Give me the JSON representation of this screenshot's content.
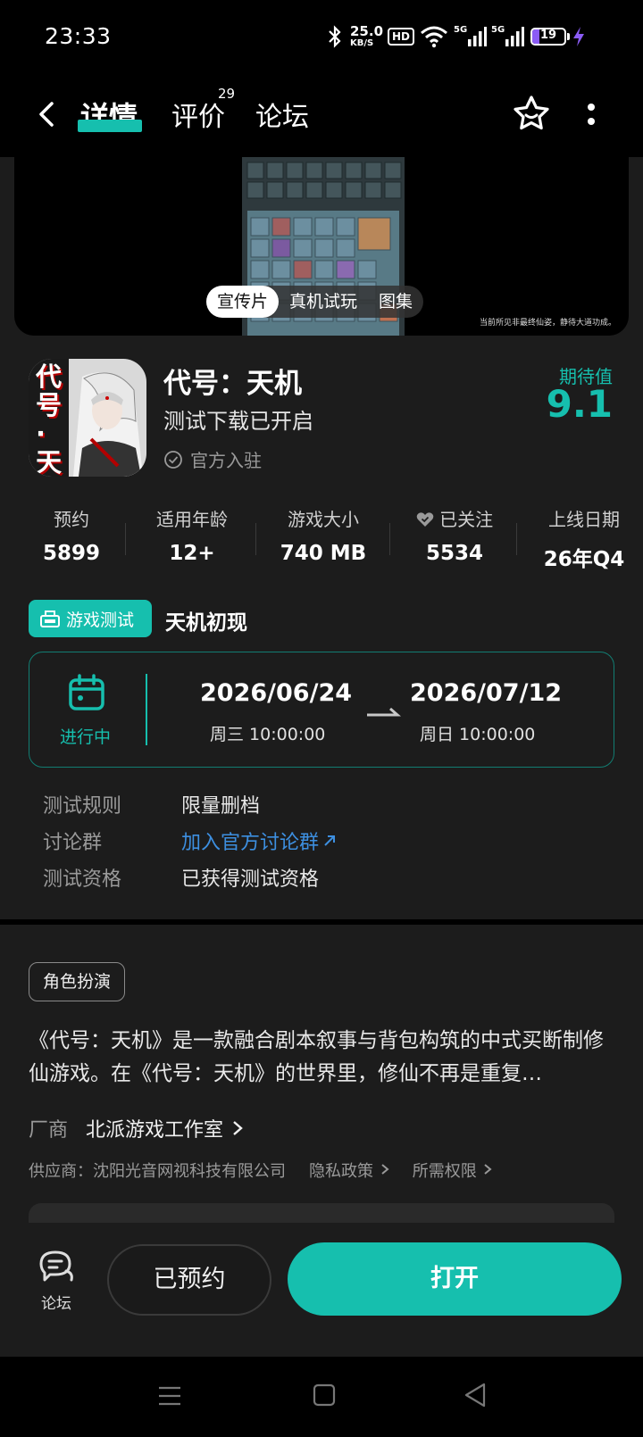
{
  "status_bar": {
    "time": "23:33",
    "net_speed": "25.0",
    "net_unit": "KB/S",
    "hd": "HD",
    "sig1": "5G",
    "sig2": "5G",
    "battery": "19"
  },
  "nav": {
    "tabs": [
      {
        "label": "详情",
        "active": true
      },
      {
        "label": "评价",
        "badge": "29"
      },
      {
        "label": "论坛"
      }
    ]
  },
  "media": {
    "tabs": [
      "宣传片",
      "真机试玩",
      "图集"
    ],
    "caption": "当前所见非最终仙姿，静待大道功成。"
  },
  "app": {
    "name": "代号：天机",
    "subtitle": "测试下载已开启",
    "official": "官方入驻",
    "expect_label": "期待值",
    "expect_value": "9.1",
    "icon_text": "代号·天机"
  },
  "stats": [
    {
      "label": "预约",
      "value": "5899"
    },
    {
      "label": "适用年龄",
      "value": "12+"
    },
    {
      "label": "游戏大小",
      "value": "740 MB"
    },
    {
      "label": "已关注",
      "value": "5534"
    },
    {
      "label": "上线日期",
      "value": "26年Q4"
    }
  ],
  "test": {
    "badge": "游戏测试",
    "title": "天机初现",
    "status": "进行中",
    "start_date": "2026/06/24",
    "start_time": "周三  10:00:00",
    "end_date": "2026/07/12",
    "end_time": "周日  10:00:00",
    "rows": [
      {
        "key": "测试规则",
        "value": "限量删档"
      },
      {
        "key": "讨论群",
        "value": "加入官方讨论群"
      },
      {
        "key": "测试资格",
        "value": "已获得测试资格"
      }
    ]
  },
  "about": {
    "genre": "角色扮演",
    "description": "《代号：天机》是一款融合剧本叙事与背包构筑的中式买断制修仙游戏。在《代号：天机》的世界里，修仙不再是重复…",
    "developer_label": "厂商",
    "developer": "北派游戏工作室",
    "supplier": "供应商：沈阳光音网视科技有限公司",
    "privacy": "隐私政策",
    "permissions": "所需权限"
  },
  "actions": {
    "forum": "论坛",
    "reserved": "已预约",
    "open": "打开"
  },
  "colors": {
    "accent": "#16bfae",
    "link": "#3d8fe0",
    "background": "#1c1c1c"
  }
}
